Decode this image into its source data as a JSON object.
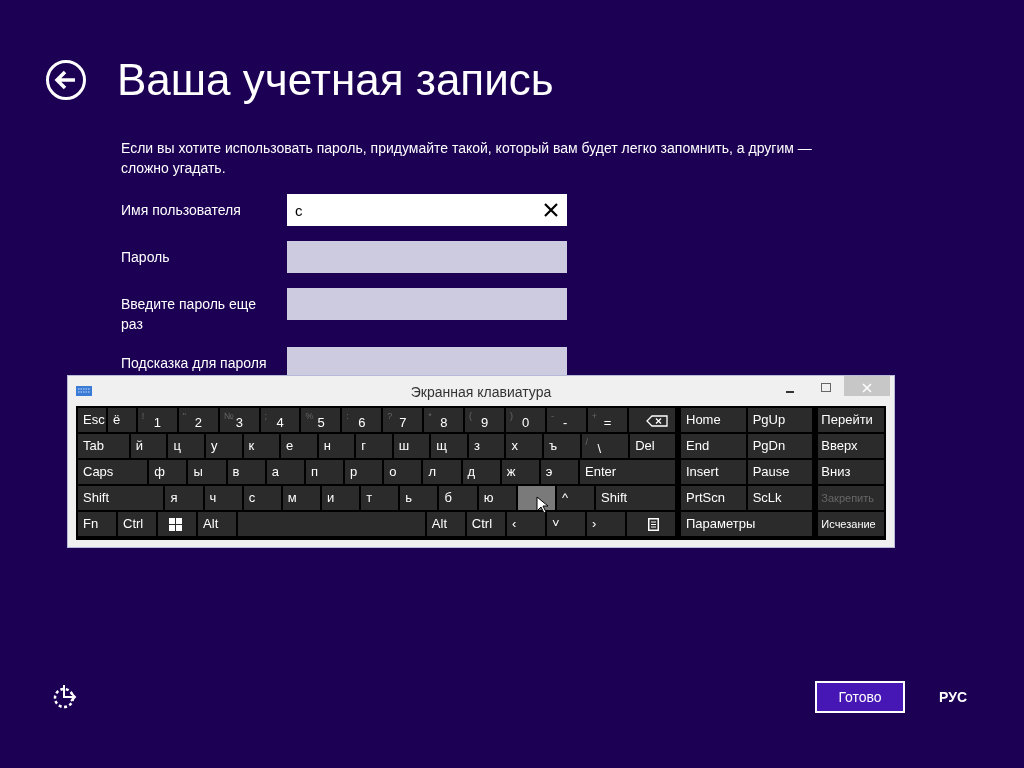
{
  "page": {
    "title": "Ваша учетная запись",
    "intro": "Если вы хотите использовать пароль, придумайте такой, который вам будет легко запомнить, а другим — сложно угадать.",
    "fields": [
      {
        "label": "Имя пользователя",
        "value": "с",
        "focused": true
      },
      {
        "label": "Пароль",
        "focused": false
      },
      {
        "label": "Введите пароль еще раз",
        "focused": false
      },
      {
        "label": "Подсказка для пароля",
        "focused": false
      }
    ],
    "done_button": "Готово",
    "language": "РУС"
  },
  "keyboard": {
    "title": "Экранная клавиатура",
    "main_rows": [
      [
        {
          "kind": "key",
          "label": "Esc",
          "hovered": false
        },
        {
          "kind": "key",
          "label": "ё",
          "hovered": false
        },
        {
          "kind": "key",
          "shift": "!",
          "label": "1",
          "hovered": false
        },
        {
          "kind": "key",
          "shift": "\"",
          "label": "2",
          "hovered": false
        },
        {
          "kind": "key",
          "shift": "№",
          "label": "3",
          "hovered": false
        },
        {
          "kind": "key",
          "shift": ";",
          "label": "4",
          "hovered": false
        },
        {
          "kind": "key",
          "shift": "%",
          "label": "5",
          "hovered": false
        },
        {
          "kind": "key",
          "shift": ":",
          "label": "6",
          "hovered": false
        },
        {
          "kind": "key",
          "shift": "?",
          "label": "7",
          "hovered": false
        },
        {
          "kind": "key",
          "shift": "*",
          "label": "8",
          "hovered": false
        },
        {
          "kind": "key",
          "shift": "(",
          "label": "9",
          "hovered": false
        },
        {
          "kind": "key",
          "shift": ")",
          "label": "0",
          "hovered": false
        },
        {
          "kind": "key",
          "shift": "-",
          "label": "-",
          "hovered": false
        },
        {
          "kind": "key",
          "shift": "+",
          "label": "=",
          "hovered": false
        },
        {
          "kind": "backspace",
          "hovered": false
        }
      ],
      [
        {
          "kind": "key",
          "label": "Tab",
          "hovered": false
        },
        {
          "kind": "key",
          "label": "й",
          "hovered": false
        },
        {
          "kind": "key",
          "label": "ц",
          "hovered": false
        },
        {
          "kind": "key",
          "label": "у",
          "hovered": false
        },
        {
          "kind": "key",
          "label": "к",
          "hovered": false
        },
        {
          "kind": "key",
          "label": "е",
          "hovered": false
        },
        {
          "kind": "key",
          "label": "н",
          "hovered": false
        },
        {
          "kind": "key",
          "label": "г",
          "hovered": false
        },
        {
          "kind": "key",
          "label": "ш",
          "hovered": false
        },
        {
          "kind": "key",
          "label": "щ",
          "hovered": false
        },
        {
          "kind": "key",
          "label": "з",
          "hovered": false
        },
        {
          "kind": "key",
          "label": "х",
          "hovered": false
        },
        {
          "kind": "key",
          "label": "ъ",
          "hovered": false
        },
        {
          "kind": "key",
          "shift": "/",
          "label": "\\",
          "hovered": false
        },
        {
          "kind": "key",
          "label": "Del",
          "hovered": false
        }
      ],
      [
        {
          "kind": "key",
          "label": "Caps",
          "hovered": false
        },
        {
          "kind": "key",
          "label": "ф",
          "hovered": false
        },
        {
          "kind": "key",
          "label": "ы",
          "hovered": false
        },
        {
          "kind": "key",
          "label": "в",
          "hovered": false
        },
        {
          "kind": "key",
          "label": "а",
          "hovered": false
        },
        {
          "kind": "key",
          "label": "п",
          "hovered": false
        },
        {
          "kind": "key",
          "label": "р",
          "hovered": false
        },
        {
          "kind": "key",
          "label": "о",
          "hovered": false
        },
        {
          "kind": "key",
          "label": "л",
          "hovered": false
        },
        {
          "kind": "key",
          "label": "д",
          "hovered": false
        },
        {
          "kind": "key",
          "label": "ж",
          "hovered": false
        },
        {
          "kind": "key",
          "label": "э",
          "hovered": false
        },
        {
          "kind": "key",
          "label": "Enter",
          "hovered": false
        }
      ],
      [
        {
          "kind": "key",
          "label": "Shift",
          "hovered": false
        },
        {
          "kind": "key",
          "label": "я",
          "hovered": false
        },
        {
          "kind": "key",
          "label": "ч",
          "hovered": false
        },
        {
          "kind": "key",
          "label": "с",
          "hovered": false
        },
        {
          "kind": "key",
          "label": "м",
          "hovered": false
        },
        {
          "kind": "key",
          "label": "и",
          "hovered": false
        },
        {
          "kind": "key",
          "label": "т",
          "hovered": false
        },
        {
          "kind": "key",
          "label": "ь",
          "hovered": false
        },
        {
          "kind": "key",
          "label": "б",
          "hovered": false
        },
        {
          "kind": "key",
          "label": "ю",
          "hovered": false
        },
        {
          "kind": "key",
          "hovered": true
        },
        {
          "kind": "key",
          "label": "^",
          "hovered": false
        },
        {
          "kind": "key",
          "label": "Shift",
          "hovered": false
        }
      ],
      [
        {
          "kind": "key",
          "label": "Fn",
          "hovered": false
        },
        {
          "kind": "key",
          "label": "Ctrl",
          "hovered": false
        },
        {
          "kind": "windows",
          "hovered": false
        },
        {
          "kind": "key",
          "label": "Alt",
          "hovered": false
        },
        {
          "kind": "key",
          "hovered": false
        },
        {
          "kind": "key",
          "label": "Alt",
          "hovered": false
        },
        {
          "kind": "key",
          "label": "Ctrl",
          "hovered": false
        },
        {
          "kind": "key",
          "label": "‹",
          "hovered": false
        },
        {
          "kind": "key",
          "label": "˅",
          "hovered": false
        },
        {
          "kind": "key",
          "label": "›",
          "hovered": false
        },
        {
          "kind": "menu",
          "hovered": false
        }
      ]
    ],
    "nav_rows": [
      [
        "Home",
        "PgUp"
      ],
      [
        "End",
        "PgDn"
      ],
      [
        "Insert",
        "Pause"
      ],
      [
        "PrtScn",
        "ScLk"
      ],
      [
        "Параметры"
      ]
    ],
    "side_keys": [
      {
        "label": "Перейти",
        "disabled": false
      },
      {
        "label": "Вверх",
        "disabled": false
      },
      {
        "label": "Вниз",
        "disabled": false
      },
      {
        "label": "Закрепить",
        "disabled": true
      },
      {
        "label": "Исчезание",
        "disabled": false
      }
    ]
  }
}
